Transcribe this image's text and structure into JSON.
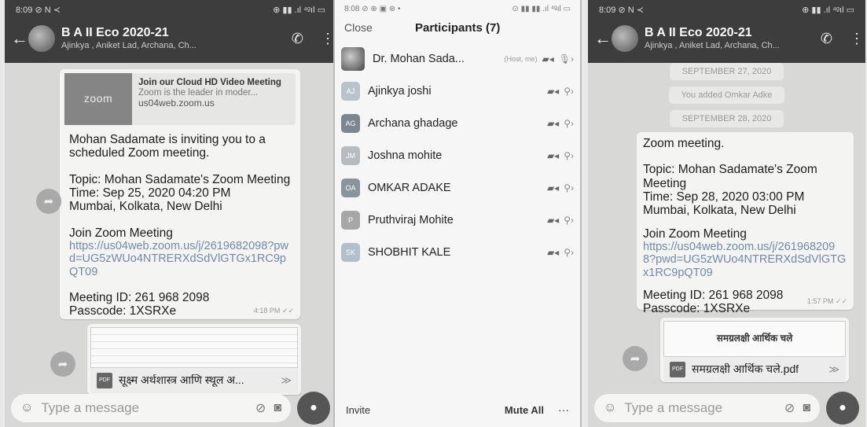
{
  "left": {
    "status_time": "8:09",
    "status_left_icons": "⊘ N ≺",
    "status_right_icons": "⊕ ▮▮ .ıl ⁴ᵍıl ▭",
    "title": "B A II Eco 2020-21",
    "subtitle": "Ajinkya , Aniket Lad, Archana, Ch...",
    "preview_logo": "zoom",
    "preview_title": "Join our Cloud HD Video Meeting",
    "preview_desc": "Zoom is the leader in moder...",
    "preview_url": "us04web.zoom.us",
    "invite_text": "Mohan Sadamate is inviting you to a scheduled Zoom meeting.",
    "topic_line": "Topic: Mohan Sadamate's Zoom Meeting",
    "time_line": "Time: Sep 25, 2020 04:20 PM",
    "tz_line": "Mumbai, Kolkata, New Delhi",
    "join_label": "Join Zoom Meeting",
    "join_link": "https://us04web.zoom.us/j/2619682098?pwd=UG5zWUo4NTRERXdSdVlGTGx1RC9pQT09",
    "meeting_id": "Meeting ID: 261 968 2098",
    "passcode": "Passcode: 1XSRXe",
    "msg_time": "4:18 PM ✓✓",
    "doc_name": "सूक्ष्म अर्थशास्त्र आणि स्थूल अ...",
    "input_placeholder": "Type a message",
    "pdf_label": "PDF"
  },
  "middle": {
    "status_time": "8:08",
    "status_left_icons": "⊘ ⊕ ▣ ⊛ •",
    "status_right_icons": "⊙ ▮▮ ▮▮ .ıl ⁴ᵍıl ▭",
    "close_label": "Close",
    "title": "Participants (7)",
    "participants": [
      {
        "initials": "",
        "name": "Dr. Mohan Sada...",
        "tag": "(Host, me)",
        "color": "#777777"
      },
      {
        "initials": "AJ",
        "name": "Ajinkya joshi",
        "tag": "",
        "color": "#b9c3cc"
      },
      {
        "initials": "AG",
        "name": "Archana ghadage",
        "tag": "",
        "color": "#7b8691"
      },
      {
        "initials": "JM",
        "name": "Joshna mohite",
        "tag": "",
        "color": "#b7bcc1"
      },
      {
        "initials": "OA",
        "name": "OMKAR ADAKE",
        "tag": "",
        "color": "#8a949c"
      },
      {
        "initials": "P",
        "name": "Pruthviraj  Mohite",
        "tag": "",
        "color": "#a7a7a7"
      },
      {
        "initials": "SK",
        "name": "SHOBHIT KALE",
        "tag": "",
        "color": "#b3c0cc"
      }
    ],
    "invite_label": "Invite",
    "mute_all_label": "Mute All",
    "more_label": "···"
  },
  "right": {
    "status_time": "8:09",
    "status_left_icons": "⊘ N ≺",
    "status_right_icons": "⊕ ▮▮ .ıl ⁴ᵍıl ▭",
    "title": "B A II Eco 2020-21",
    "subtitle": "Ajinkya , Aniket Lad, Archana, Ch...",
    "date1": "SEPTEMBER 27, 2020",
    "system_msg": "You added Omkar Adke",
    "date2": "SEPTEMBER 28, 2020",
    "heading": "Zoom meeting.",
    "topic_line": "Topic: Mohan Sadamate's Zoom Meeting",
    "time_line": "Time: Sep 28, 2020 03:00 PM",
    "tz_line": "Mumbai, Kolkata, New Delhi",
    "join_label": "Join Zoom Meeting",
    "join_link": "https://us04web.zoom.us/j/2619682098?pwd=UG5zWUo4NTRERXdSdVlGTGx1RC9pQT09",
    "meeting_id": "Meeting ID: 261 968 2098",
    "passcode": "Passcode: 1XSRXe",
    "msg_time": "1:57 PM ✓✓",
    "doc_thumb_title": "समग्रलक्षी आर्थिक चले",
    "doc_name": "समग्रलक्षी आर्थिक चले.pdf",
    "input_placeholder": "Type a message",
    "pdf_label": "PDF"
  }
}
